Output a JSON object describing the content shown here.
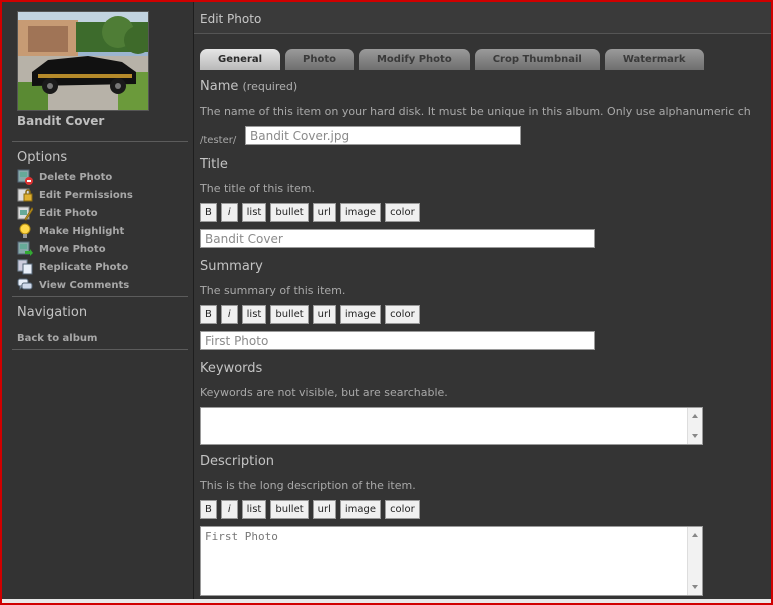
{
  "sidebar": {
    "item_title": "Bandit Cover",
    "options_heading": "Options",
    "options": [
      {
        "label": "Delete Photo",
        "icon": "delete-photo-icon"
      },
      {
        "label": "Edit Permissions",
        "icon": "lock-icon"
      },
      {
        "label": "Edit Photo",
        "icon": "edit-icon"
      },
      {
        "label": "Make Highlight",
        "icon": "lightbulb-icon"
      },
      {
        "label": "Move Photo",
        "icon": "move-icon"
      },
      {
        "label": "Replicate Photo",
        "icon": "copy-icon"
      },
      {
        "label": "View Comments",
        "icon": "comments-icon"
      }
    ],
    "navigation_heading": "Navigation",
    "back_link": "Back to album"
  },
  "main": {
    "title": "Edit Photo",
    "tabs": [
      {
        "label": "General",
        "active": true
      },
      {
        "label": "Photo",
        "active": false
      },
      {
        "label": "Modify Photo",
        "active": false
      },
      {
        "label": "Crop Thumbnail",
        "active": false
      },
      {
        "label": "Watermark",
        "active": false
      }
    ],
    "name": {
      "label": "Name",
      "required": "(required)",
      "help": "The name of this item on your hard disk. It must be unique in this album. Only use alphanumeric ch",
      "prefix": "/tester/",
      "value": "Bandit Cover.jpg"
    },
    "title_field": {
      "label": "Title",
      "help": "The title of this item.",
      "value": "Bandit Cover"
    },
    "summary_field": {
      "label": "Summary",
      "help": "The summary of this item.",
      "value": "First Photo"
    },
    "keywords_field": {
      "label": "Keywords",
      "help": "Keywords are not visible, but are searchable.",
      "value": ""
    },
    "description_field": {
      "label": "Description",
      "help": "This is the long description of the item.",
      "value": "First Photo"
    },
    "toolbar": {
      "bold": "B",
      "italic": "i",
      "list": "list",
      "bullet": "bullet",
      "url": "url",
      "image": "image",
      "color": "color"
    }
  },
  "colors": {
    "frame_border": "#d00000",
    "background": "#323232",
    "text": "#c4c4c4"
  }
}
